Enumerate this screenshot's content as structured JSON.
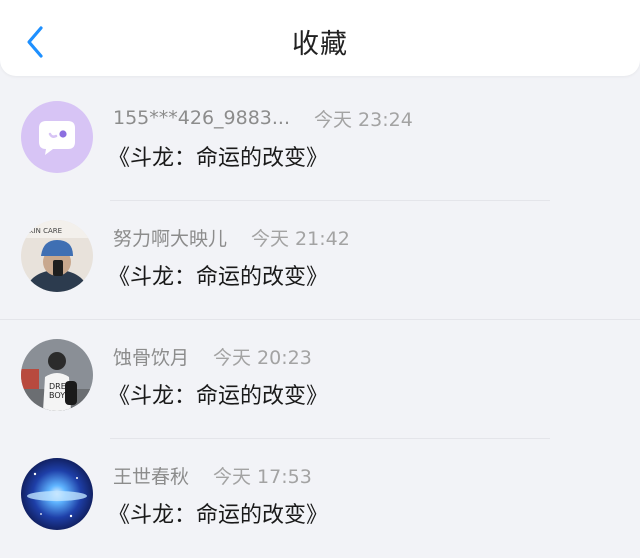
{
  "header": {
    "title": "收藏",
    "back_icon": "chevron-left-icon",
    "accent_color": "#1e90ff"
  },
  "items": [
    {
      "name": "155***426_9883...",
      "time": "今天 23:24",
      "content": "《斗龙：命运的改变》",
      "avatar": "chat-bubble-avatar"
    },
    {
      "name": "努力啊大映儿",
      "time": "今天 21:42",
      "content": "《斗龙：命运的改变》",
      "avatar": "photo-avatar"
    },
    {
      "name": "蚀骨饮月",
      "time": "今天 20:23",
      "content": "《斗龙：命运的改变》",
      "avatar": "photo-avatar"
    },
    {
      "name": "王世春秋",
      "time": "今天 17:53",
      "content": "《斗龙：命运的改变》",
      "avatar": "galaxy-avatar"
    }
  ]
}
